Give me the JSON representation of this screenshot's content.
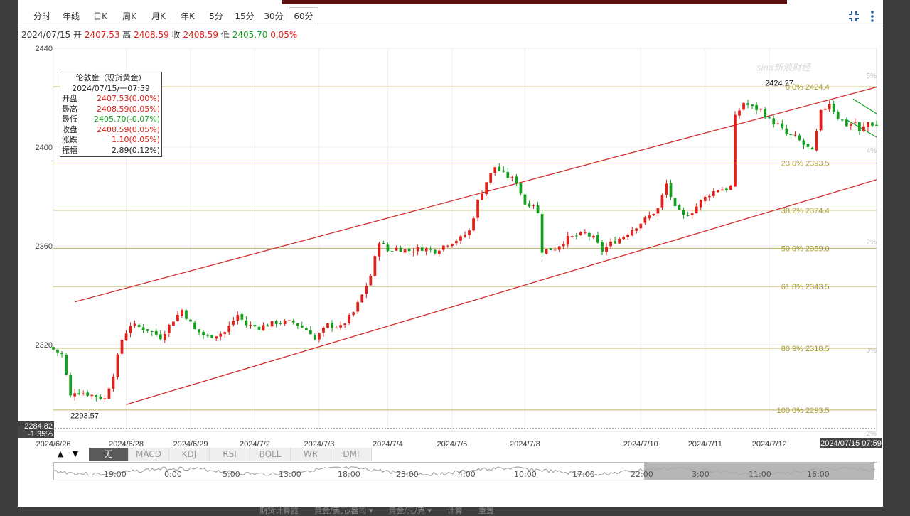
{
  "tabs": [
    {
      "label": "分时"
    },
    {
      "label": "年线"
    },
    {
      "label": "日K"
    },
    {
      "label": "周K"
    },
    {
      "label": "月K"
    },
    {
      "label": "年K"
    },
    {
      "label": "5分"
    },
    {
      "label": "15分"
    },
    {
      "label": "30分"
    },
    {
      "label": "60分",
      "active": true
    }
  ],
  "icons": {
    "fullscreen": "fullscreen-icon",
    "more": "more-vertical-icon"
  },
  "info": {
    "date": "2024/07/15",
    "open_label": "开",
    "open": "2407.53",
    "high_label": "高",
    "high": "2408.59",
    "close_label": "收",
    "close": "2408.59",
    "low_label": "低",
    "low": "2405.70",
    "change": "0.05%"
  },
  "tooltip": {
    "title": "伦敦金（现货黄金）",
    "time": "2024/07/15/一07:59",
    "rows": [
      {
        "k": "开盘",
        "v": "2407.53(0.00%)",
        "color": "#e0201a"
      },
      {
        "k": "最高",
        "v": "2408.59(0.05%)",
        "color": "#e0201a"
      },
      {
        "k": "最低",
        "v": "2405.70(-0.07%)",
        "color": "#12a01e"
      },
      {
        "k": "收盘",
        "v": "2408.59(0.05%)",
        "color": "#e0201a"
      },
      {
        "k": "涨跌",
        "v": "1.10(0.05%)",
        "color": "#e0201a"
      },
      {
        "k": "振幅",
        "v": "2.89(0.12%)",
        "color": "#222222"
      }
    ]
  },
  "watermark": "sina新浪财经",
  "indicators": {
    "up_arrow": "▲",
    "down_arrow": "▼",
    "items": [
      {
        "label": "无",
        "active": true
      },
      {
        "label": "MACD"
      },
      {
        "label": "KDJ"
      },
      {
        "label": "RSI"
      },
      {
        "label": "BOLL"
      },
      {
        "label": "WR"
      },
      {
        "label": "DMI"
      }
    ]
  },
  "navigator": {
    "labels": [
      "19:00",
      "0:00",
      "5:00",
      "13:00",
      "18:00",
      "23:00",
      "4:00",
      "10:00",
      "17:00",
      "22:00",
      "3:00",
      "11:00",
      "16:00"
    ]
  },
  "footer": "期货计算器　　黄金/美元/盎司 ▾　　黄金/元/克 ▾　　计算　　重置",
  "colors": {
    "up": "#e0201a",
    "down": "#12a01e",
    "channel": "#d03030",
    "fib": "#bfb46a",
    "fibtext": "#a89a30",
    "grid": "#eeeeee"
  },
  "chart_data": {
    "type": "candlestick",
    "title": "伦敦金（现货黄金） 60分",
    "ylim": [
      2284.82,
      2440
    ],
    "x_range": [
      0,
      192
    ],
    "y_ticks": [
      2320,
      2360,
      2400,
      2440
    ],
    "y_tick_labels": [
      "2320",
      "2360",
      "2400",
      "2440"
    ],
    "right_pct_ticks": [
      {
        "v": 2429.0,
        "label": "5%"
      },
      {
        "v": 2398.9,
        "label": "4%"
      },
      {
        "v": 2361.8,
        "label": "2%"
      },
      {
        "v": 2317.9,
        "label": "0%"
      },
      {
        "v": 2284.2,
        "label": "-2%"
      }
    ],
    "last_axis_value": {
      "value": "2284.82",
      "pct": "-1.35%"
    },
    "x_labels": [
      {
        "x": 0,
        "label": "2024/6/26"
      },
      {
        "x": 17,
        "label": "2024/6/28"
      },
      {
        "x": 32,
        "label": "2024/6/29"
      },
      {
        "x": 47,
        "label": "2024/7/2"
      },
      {
        "x": 62,
        "label": "2024/7/3"
      },
      {
        "x": 78,
        "label": "2024/7/4"
      },
      {
        "x": 93,
        "label": "2024/7/5"
      },
      {
        "x": 110,
        "label": "2024/7/8"
      },
      {
        "x": 137,
        "label": "2024/7/10"
      },
      {
        "x": 152,
        "label": "2024/7/11"
      },
      {
        "x": 167,
        "label": "2024/7/12"
      }
    ],
    "last_x_label": "2024/07/15 07:59",
    "extremes": [
      {
        "x": 4,
        "value": 2293.57,
        "label": "2293.57"
      },
      {
        "x": 166,
        "value": 2424.27,
        "label": "2424.27"
      }
    ],
    "fibonacci": [
      {
        "level": "0.0%",
        "value": 2424.4
      },
      {
        "level": "23.6%",
        "value": 2393.5
      },
      {
        "level": "38.2%",
        "value": 2374.4
      },
      {
        "level": "50.0%",
        "value": 2359.0
      },
      {
        "level": "61.8%",
        "value": 2343.5
      },
      {
        "level": "80.9%",
        "value": 2318.5
      },
      {
        "level": "100.0%",
        "value": 2293.5
      }
    ],
    "fib_extra_line": 2393.5,
    "channel": [
      {
        "x1": 5,
        "y1": 2337.3,
        "x2": 192,
        "y2": 2424.3
      },
      {
        "x1": 17,
        "y1": 2295.7,
        "x2": 192,
        "y2": 2386.8
      }
    ],
    "wedge": [
      {
        "x1": 186.5,
        "y1": 2419.5,
        "x2": 192,
        "y2": 2413.5
      },
      {
        "x1": 185.3,
        "y1": 2410.8,
        "x2": 192,
        "y2": 2404.0
      }
    ],
    "close_anchors": [
      [
        0,
        2318
      ],
      [
        2,
        2316
      ],
      [
        4,
        2299
      ],
      [
        5,
        2301
      ],
      [
        8,
        2300
      ],
      [
        12,
        2298
      ],
      [
        14,
        2308
      ],
      [
        16,
        2322
      ],
      [
        18,
        2328
      ],
      [
        22,
        2326
      ],
      [
        25,
        2323
      ],
      [
        28,
        2330
      ],
      [
        30,
        2334
      ],
      [
        33,
        2326
      ],
      [
        36,
        2323
      ],
      [
        40,
        2325
      ],
      [
        43,
        2332
      ],
      [
        45,
        2328
      ],
      [
        48,
        2327
      ],
      [
        52,
        2329
      ],
      [
        56,
        2329
      ],
      [
        60,
        2325
      ],
      [
        61,
        2322
      ],
      [
        64,
        2328
      ],
      [
        67,
        2327
      ],
      [
        70,
        2333
      ],
      [
        72,
        2340
      ],
      [
        74,
        2348
      ],
      [
        76,
        2362
      ],
      [
        78,
        2358
      ],
      [
        80,
        2359
      ],
      [
        83,
        2358
      ],
      [
        86,
        2359
      ],
      [
        89,
        2358
      ],
      [
        92,
        2361
      ],
      [
        95,
        2363
      ],
      [
        97,
        2366
      ],
      [
        99,
        2378
      ],
      [
        101,
        2386
      ],
      [
        103,
        2392
      ],
      [
        105,
        2389
      ],
      [
        108,
        2386
      ],
      [
        110,
        2377
      ],
      [
        112,
        2377
      ],
      [
        113,
        2373
      ],
      [
        114,
        2358
      ],
      [
        117,
        2359
      ],
      [
        120,
        2363
      ],
      [
        122,
        2364
      ],
      [
        124,
        2365
      ],
      [
        126,
        2363
      ],
      [
        128,
        2358
      ],
      [
        130,
        2361
      ],
      [
        133,
        2364
      ],
      [
        136,
        2368
      ],
      [
        139,
        2372
      ],
      [
        141,
        2375
      ],
      [
        143,
        2385
      ],
      [
        145,
        2375
      ],
      [
        147,
        2372
      ],
      [
        149,
        2374
      ],
      [
        151,
        2378
      ],
      [
        153,
        2381
      ],
      [
        155,
        2383
      ],
      [
        157,
        2383
      ],
      [
        158,
        2384
      ],
      [
        159,
        2412
      ],
      [
        161,
        2418
      ],
      [
        163,
        2416
      ],
      [
        165,
        2415
      ],
      [
        167,
        2411
      ],
      [
        169,
        2409
      ],
      [
        171,
        2405
      ],
      [
        173,
        2404
      ],
      [
        175,
        2401
      ],
      [
        177,
        2398
      ],
      [
        179,
        2414
      ],
      [
        181,
        2418
      ],
      [
        183,
        2412
      ],
      [
        185,
        2409
      ],
      [
        187,
        2410
      ],
      [
        188,
        2406
      ],
      [
        190,
        2410
      ],
      [
        192,
        2408.6
      ]
    ]
  }
}
